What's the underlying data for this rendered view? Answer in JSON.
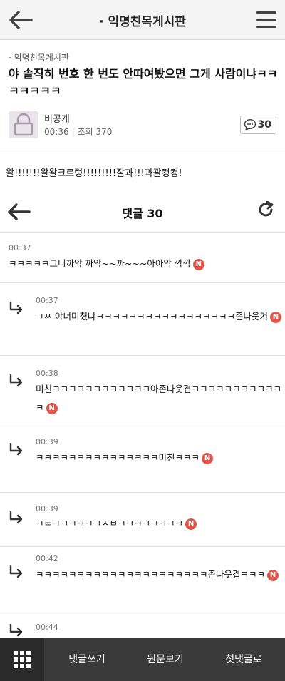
{
  "header": {
    "title": "· 익명친목게시판"
  },
  "post": {
    "board": "· 익명친목게시판",
    "title": "야 솔직히 번호 한 번도 안따여봤으면 그게 사람이냐ㅋㅋㅋㅋㅋㅋㅋ",
    "author": "비공개",
    "time": "00:36",
    "views_label": "조회 370",
    "comment_count": "30",
    "body": "왈!!!!!!!왈왈크르렁!!!!!!!!!잘과!!!과괄컹컹!"
  },
  "comments_section": {
    "label": "댓글 30"
  },
  "comments": [
    {
      "time": "00:37",
      "text": "ㅋㅋㅋㅋㅋ그니까악 까악~~까~~~아아악 깍깍",
      "reply": false,
      "new_badge": "N"
    },
    {
      "time": "00:37",
      "text": "ㄱㅆ 야너미쳤냐ㅋㅋㅋㅋㅋㅋㅋㅋㅋㅋㅋㅋㅋㅋㅋㅋㅋ존나웃겨",
      "reply": true,
      "new_badge": "N"
    },
    {
      "time": "00:38",
      "text": "미친ㅋㅋㅋㅋㅋㅋㅋㅋㅋㅋㅋㅋ아존나웃겹ㅋㅋㅋㅋㅋㅋㅋㅋㅋㅋㅋㅋ",
      "reply": true,
      "new_badge": "N"
    },
    {
      "time": "00:39",
      "text": "ㅋㅋㅋㅋㅋㅋㅋㅋㅋㅋㅋㅋㅋㅋㅋ미친ㅋㅋㅋ",
      "reply": true,
      "new_badge": "N"
    },
    {
      "time": "00:39",
      "text": "ㅋㅌㅋㅋㅋㅋㅋㅋㅅㅂㅋㅋㅋㅋㅋㅋㅋㅋ",
      "reply": true,
      "new_badge": "N"
    },
    {
      "time": "00:42",
      "text": "ㅋㅋㅋㅋㅋㅋㅋㅋㅋㅋㅋㅋㅋㅋㅋㅋㅋㅋㅋㅋㅋ존나웃겹ㅋㅋㅋ",
      "reply": true,
      "new_badge": "N"
    },
    {
      "time": "00:44",
      "text": "",
      "reply": true,
      "new_badge": ""
    }
  ],
  "bottombar": {
    "write_comment": "댓글쓰기",
    "view_original": "원문보기",
    "first_comment": "첫댓글로"
  },
  "colors": {
    "new_badge": "#e25548",
    "bottombar": "#3a3a3a",
    "grid_button": "#2a2a2a"
  },
  "icons": {
    "back": "left-arrow-icon",
    "menu": "hamburger-menu-icon",
    "avatar": "lock-avatar-icon",
    "comment_bubble": "speech-bubble-icon",
    "refresh": "refresh-icon",
    "reply": "reply-arrow-icon",
    "grid": "grid-menu-icon"
  }
}
